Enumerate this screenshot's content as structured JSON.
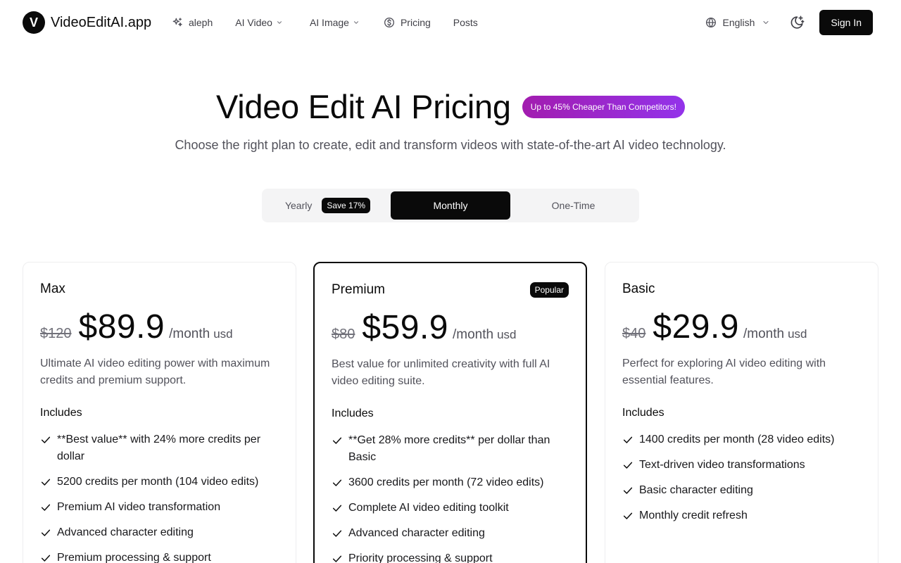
{
  "header": {
    "logo_letter": "V",
    "logo_text": "VideoEditAI.app",
    "nav": {
      "aleph": "aleph",
      "ai_video": "AI Video",
      "ai_image": "AI Image",
      "pricing": "Pricing",
      "posts": "Posts"
    },
    "language": "English",
    "sign_in": "Sign In"
  },
  "hero": {
    "title": "Video Edit AI Pricing",
    "promo_badge": "Up to 45% Cheaper Than Competitors!",
    "subtitle": "Choose the right plan to create, edit and transform videos with state-of-the-art AI video technology."
  },
  "billing": {
    "yearly": "Yearly",
    "save_badge": "Save 17%",
    "monthly": "Monthly",
    "one_time": "One-Time",
    "selected": "Monthly"
  },
  "plans": {
    "max": {
      "name": "Max",
      "old_price": "$120",
      "price": "$89.9",
      "per": "/month",
      "currency": "usd",
      "description": "Ultimate AI video editing power with maximum credits and premium support.",
      "includes_label": "Includes",
      "features": [
        "**Best value** with 24% more credits per dollar",
        "5200 credits per month (104 video edits)",
        "Premium AI video transformation",
        "Advanced character editing",
        "Premium processing & support"
      ]
    },
    "premium": {
      "name": "Premium",
      "badge": "Popular",
      "old_price": "$80",
      "price": "$59.9",
      "per": "/month",
      "currency": "usd",
      "description": "Best value for unlimited creativity with full AI video editing suite.",
      "includes_label": "Includes",
      "features": [
        "**Get 28% more credits** per dollar than Basic",
        "3600 credits per month (72 video edits)",
        "Complete AI video editing toolkit",
        "Advanced character editing",
        "Priority processing & support"
      ]
    },
    "basic": {
      "name": "Basic",
      "old_price": "$40",
      "price": "$29.9",
      "per": "/month",
      "currency": "usd",
      "description": "Perfect for exploring AI video editing with essential features.",
      "includes_label": "Includes",
      "features": [
        "1400 credits per month (28 video edits)",
        "Text-driven video transformations",
        "Basic character editing",
        "Monthly credit refresh"
      ]
    }
  },
  "colors": {
    "primary": "#0a0a0a",
    "promo_gradient_start": "#a21caf",
    "promo_gradient_end": "#9333ea",
    "muted_text": "#52525b",
    "toggle_bg": "#f4f4f5"
  },
  "icons": {
    "aleph": "sparkles-icon",
    "pricing": "dollar-circle-icon",
    "language": "globe-icon",
    "theme": "moon-sparkle-icon",
    "dropdown": "chevron-down-icon",
    "feature": "check-icon"
  }
}
